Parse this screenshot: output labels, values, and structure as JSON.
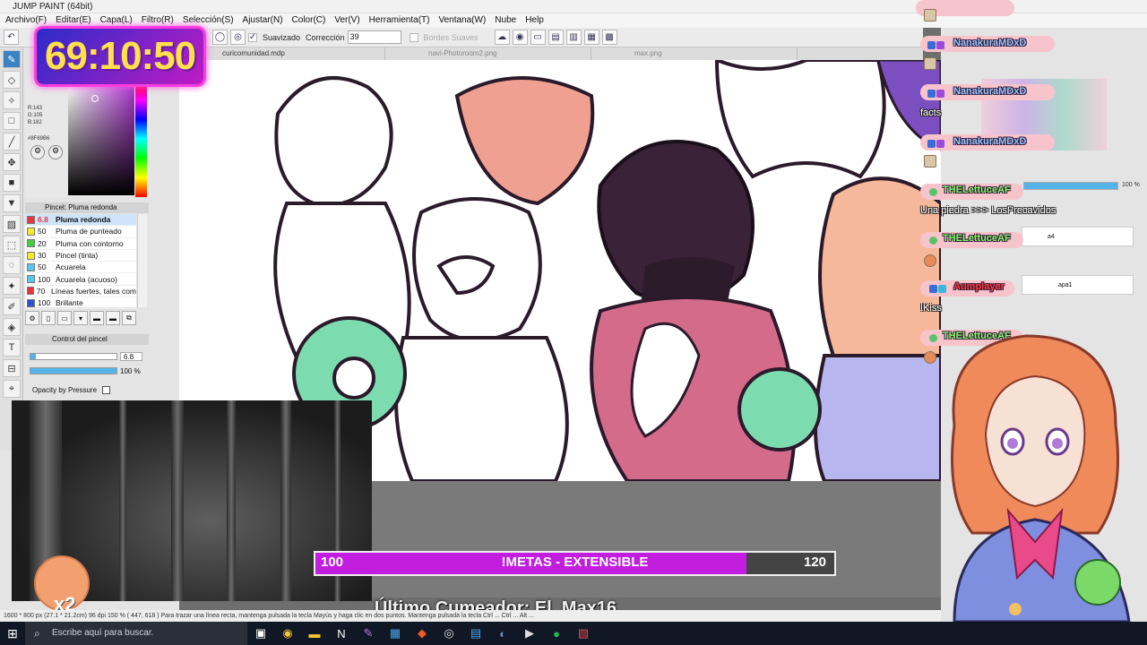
{
  "window": {
    "title": "JUMP PAINT (64bit)"
  },
  "menu": [
    "Archivo(F)",
    "Editar(E)",
    "Capa(L)",
    "Filtro(R)",
    "Selección(S)",
    "Ajustar(N)",
    "Color(C)",
    "Ver(V)",
    "Herramienta(T)",
    "Ventana(W)",
    "Nube",
    "Help"
  ],
  "toolbar": {
    "smooth_label": "Suavizado",
    "correction_label": "Corrección",
    "correction_value": "39",
    "soft_edges_label": "Bordes Suaves"
  },
  "tabs": [
    "curicomunidad.mdp",
    "navi-Photoroom2.png",
    "max.png"
  ],
  "timer": "69:10:50",
  "color": {
    "r": "R:143",
    "g": "G:105",
    "b": "B:182",
    "hex": "#8F69B6"
  },
  "brush_panel": {
    "title": "Pincel: Pluma redonda",
    "items": [
      {
        "size": "6.8",
        "name": "Pluma redonda",
        "swatch": "#e8343e",
        "selected": true
      },
      {
        "size": "50",
        "name": "Pluma de punteado",
        "swatch": "#f5ea2a"
      },
      {
        "size": "20",
        "name": "Pluma con contorno",
        "swatch": "#3fcf3f"
      },
      {
        "size": "30",
        "name": "Pincel (tinta)",
        "swatch": "#f5ea2a"
      },
      {
        "size": "50",
        "name": "Acuarela",
        "swatch": "#5ac6f0"
      },
      {
        "size": "100",
        "name": "Acuarela (acuoso)",
        "swatch": "#5ac6f0"
      },
      {
        "size": "70",
        "name": "Líneas fuertes, tales com",
        "swatch": "#e8343e"
      },
      {
        "size": "100",
        "name": "Brillante",
        "swatch": "#2b4fd6"
      }
    ]
  },
  "pen_control": {
    "title": "Control del pincel",
    "size_value": "6.8",
    "opacity_value": "100 %",
    "size_fraction": 0.06,
    "opacity_fraction": 1.0,
    "pressure_label": "Opacity by Pressure"
  },
  "goal": {
    "min": "100",
    "label": "!METAS - EXTENSIBLE",
    "max": "120",
    "fraction": 0.83
  },
  "last_cumeador": "Último Cumeador: El_Max16",
  "statusbar": "1600 * 800 px   (27.1 * 21.2cm)   96 dpi   150 %   ( 447, 618 )   Para trazar una línea recta, mantenga pulsada la tecla Mayús y haga clic en dos puntos. Mantenga pulsada la tecla Ctrl ... Ctrl ... Alt ...",
  "taskbar": {
    "search_placeholder": "Escribe aquí para buscar."
  },
  "chat": [
    {
      "user": "NanakuraMDxD",
      "message": "",
      "color": "#8ec9ff"
    },
    {
      "user": "NanakuraMDxD",
      "message": "facts",
      "color": "#8ec9ff"
    },
    {
      "user": "NanakuraMDxD",
      "message": "",
      "color": "#8ec9ff"
    },
    {
      "user": "THELettuceAF",
      "message": "Una piedra >>> LosPrecavidos",
      "color": "#7dfc6a"
    },
    {
      "user": "THELettuceAF",
      "message": "",
      "color": "#7dfc6a"
    },
    {
      "user": "Aumplayer",
      "message": "!Kiss",
      "color": "#ff3a3a"
    },
    {
      "user": "THELettuceAF",
      "message": "",
      "color": "#7dfc6a"
    }
  ],
  "right_panel": {
    "percent": "100 %",
    "field1": "a4",
    "field2": "apa1"
  },
  "webcam_badge": "x2"
}
